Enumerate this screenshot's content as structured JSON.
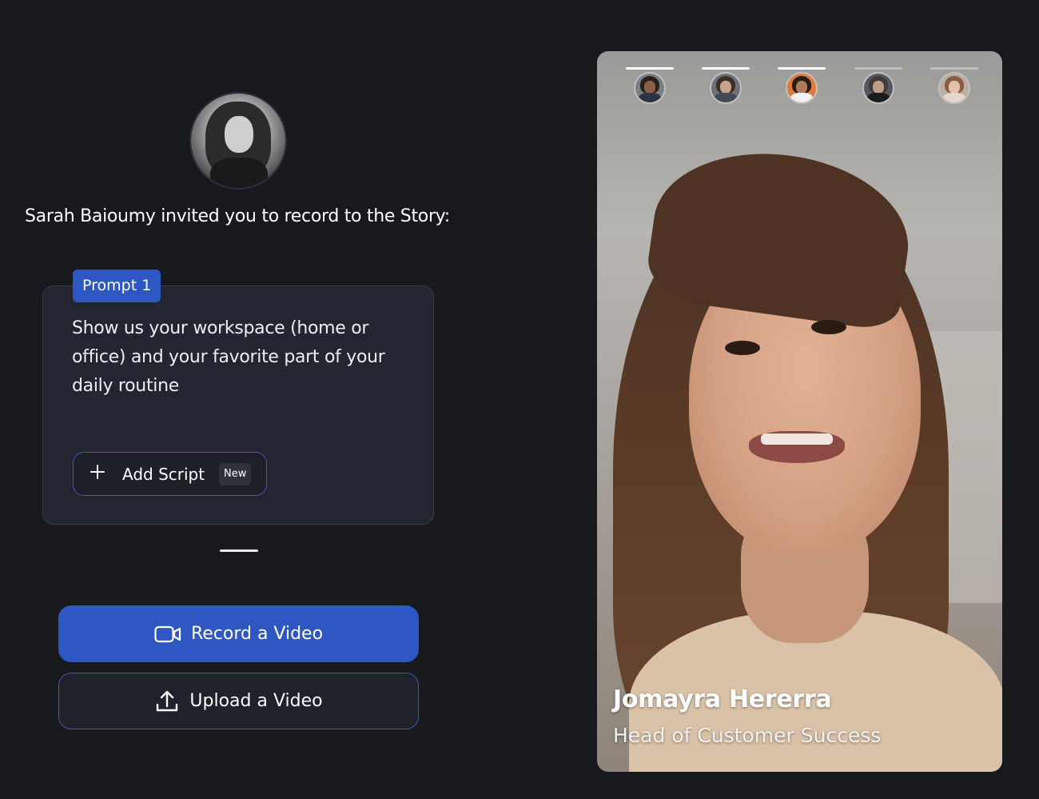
{
  "invite": {
    "text": "Sarah Baioumy invited you to record to the Story:"
  },
  "prompt": {
    "badge": "Prompt 1",
    "text": "Show us your workspace (home or office) and your favorite part of your daily routine",
    "add_script_label": "Add Script",
    "new_badge": "New"
  },
  "actions": {
    "record_label": "Record a Video",
    "upload_label": "Upload a Video"
  },
  "video": {
    "name": "Jomayra Hererra",
    "role": "Head of Customer Success",
    "active_index": 2,
    "story_count": 5
  },
  "colors": {
    "background": "#18191c",
    "card": "#232530",
    "accent": "#2e57c3",
    "accent_border": "#3b5bb6"
  }
}
